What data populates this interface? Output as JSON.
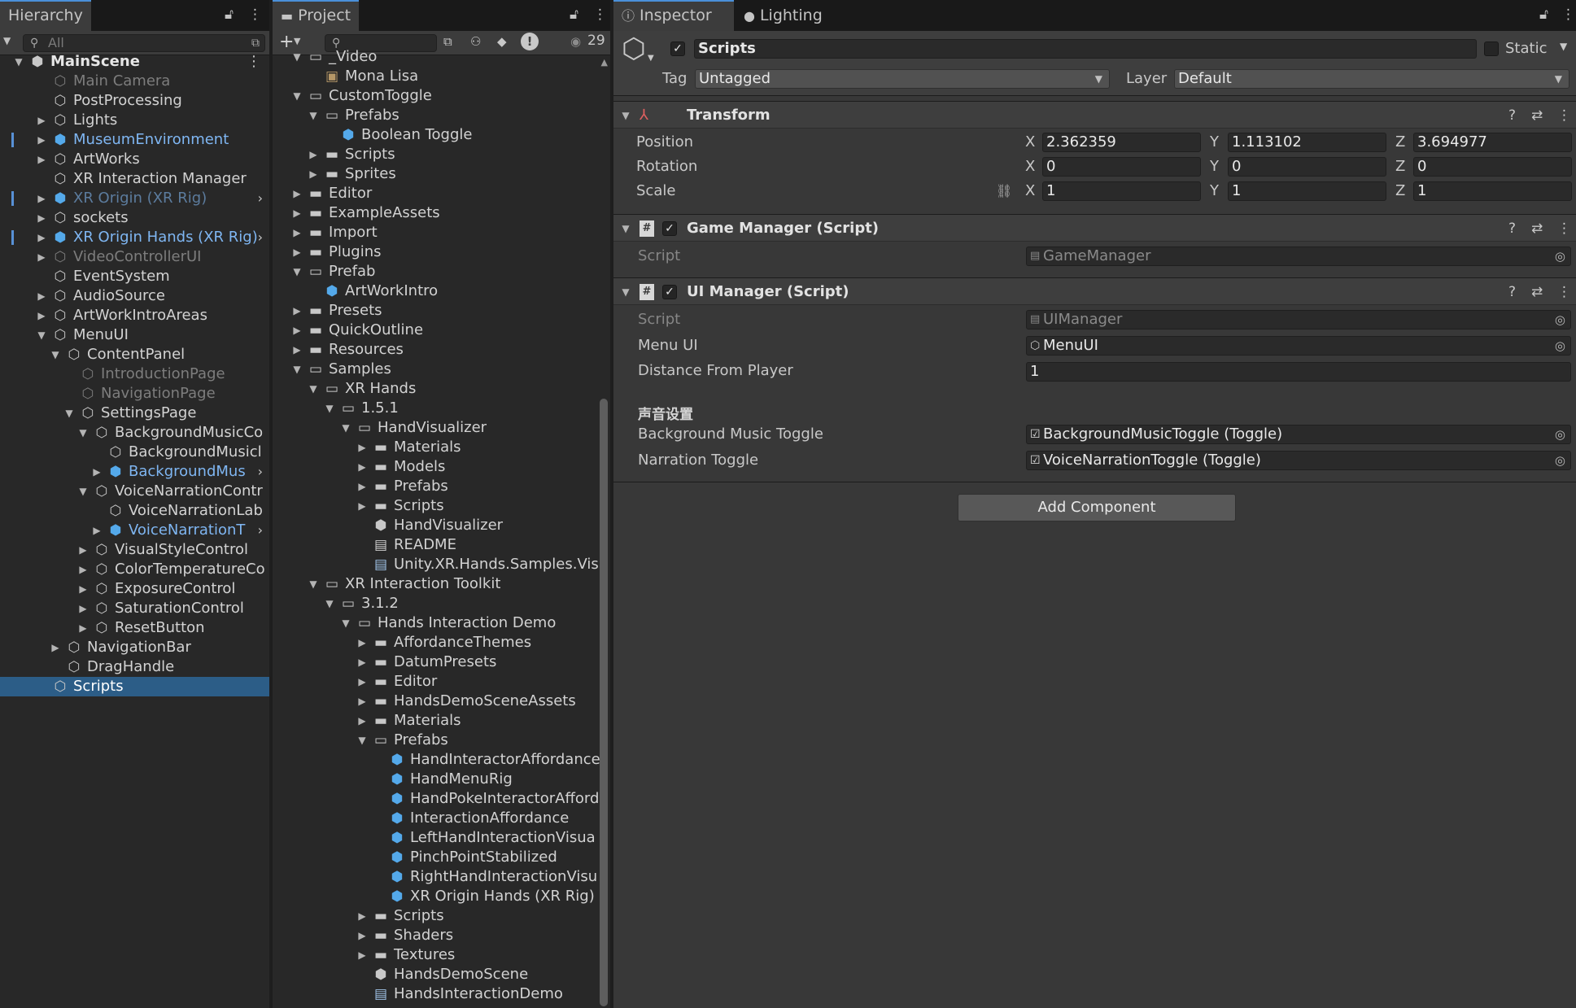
{
  "hierarchy": {
    "tab_label": "Hierarchy",
    "search_placeholder": "All",
    "scene_name": "MainScene",
    "items": [
      {
        "label": "Main Camera",
        "depth": 1,
        "arrow": "",
        "icon": "gameobject-icon",
        "style": "dim"
      },
      {
        "label": "PostProcessing",
        "depth": 1,
        "arrow": "",
        "icon": "gameobject-icon",
        "style": "normal"
      },
      {
        "label": "Lights",
        "depth": 1,
        "arrow": "right",
        "icon": "gameobject-icon",
        "style": "normal"
      },
      {
        "label": "MuseumEnvironment",
        "depth": 1,
        "arrow": "right",
        "icon": "prefab-icon",
        "style": "prefab",
        "stripe": true
      },
      {
        "label": "ArtWorks",
        "depth": 1,
        "arrow": "right",
        "icon": "gameobject-icon",
        "style": "normal"
      },
      {
        "label": "XR Interaction Manager",
        "depth": 1,
        "arrow": "",
        "icon": "gameobject-icon",
        "style": "normal"
      },
      {
        "label": "XR Origin (XR Rig)",
        "depth": 1,
        "arrow": "right",
        "icon": "prefab-icon",
        "style": "prefab-dim",
        "stripe": true,
        "chevron": true
      },
      {
        "label": "sockets",
        "depth": 1,
        "arrow": "right",
        "icon": "gameobject-icon",
        "style": "normal"
      },
      {
        "label": "XR Origin Hands (XR Rig)",
        "depth": 1,
        "arrow": "right",
        "icon": "prefab-icon",
        "style": "prefab",
        "stripe": true,
        "chevron": true
      },
      {
        "label": "VideoControllerUI",
        "depth": 1,
        "arrow": "right",
        "icon": "gameobject-icon",
        "style": "dim"
      },
      {
        "label": "EventSystem",
        "depth": 1,
        "arrow": "",
        "icon": "gameobject-icon",
        "style": "normal"
      },
      {
        "label": "AudioSource",
        "depth": 1,
        "arrow": "right",
        "icon": "gameobject-icon",
        "style": "normal"
      },
      {
        "label": "ArtWorkIntroAreas",
        "depth": 1,
        "arrow": "right",
        "icon": "gameobject-icon",
        "style": "normal"
      },
      {
        "label": "MenuUI",
        "depth": 1,
        "arrow": "down",
        "icon": "gameobject-icon",
        "style": "normal"
      },
      {
        "label": "ContentPanel",
        "depth": 2,
        "arrow": "down",
        "icon": "gameobject-icon",
        "style": "normal"
      },
      {
        "label": "IntroductionPage",
        "depth": 3,
        "arrow": "",
        "icon": "gameobject-icon",
        "style": "dim"
      },
      {
        "label": "NavigationPage",
        "depth": 3,
        "arrow": "",
        "icon": "gameobject-icon",
        "style": "dim"
      },
      {
        "label": "SettingsPage",
        "depth": 3,
        "arrow": "down",
        "icon": "gameobject-icon",
        "style": "normal"
      },
      {
        "label": "BackgroundMusicCo",
        "depth": 4,
        "arrow": "down",
        "icon": "gameobject-icon",
        "style": "normal"
      },
      {
        "label": "BackgroundMusicl",
        "depth": 5,
        "arrow": "",
        "icon": "gameobject-icon",
        "style": "normal"
      },
      {
        "label": "BackgroundMus",
        "depth": 5,
        "arrow": "right",
        "icon": "prefab-icon",
        "style": "prefab",
        "chevron": true
      },
      {
        "label": "VoiceNarrationContr",
        "depth": 4,
        "arrow": "down",
        "icon": "gameobject-icon",
        "style": "normal"
      },
      {
        "label": "VoiceNarrationLab",
        "depth": 5,
        "arrow": "",
        "icon": "gameobject-icon",
        "style": "normal"
      },
      {
        "label": "VoiceNarrationT",
        "depth": 5,
        "arrow": "right",
        "icon": "prefab-icon",
        "style": "prefab",
        "chevron": true
      },
      {
        "label": "VisualStyleControl",
        "depth": 4,
        "arrow": "right",
        "icon": "gameobject-icon",
        "style": "normal"
      },
      {
        "label": "ColorTemperatureCo",
        "depth": 4,
        "arrow": "right",
        "icon": "gameobject-icon",
        "style": "normal"
      },
      {
        "label": "ExposureControl",
        "depth": 4,
        "arrow": "right",
        "icon": "gameobject-icon",
        "style": "normal"
      },
      {
        "label": "SaturationControl",
        "depth": 4,
        "arrow": "right",
        "icon": "gameobject-icon",
        "style": "normal"
      },
      {
        "label": "ResetButton",
        "depth": 4,
        "arrow": "right",
        "icon": "gameobject-icon",
        "style": "normal"
      },
      {
        "label": "NavigationBar",
        "depth": 2,
        "arrow": "right",
        "icon": "gameobject-icon",
        "style": "normal"
      },
      {
        "label": "DragHandle",
        "depth": 2,
        "arrow": "",
        "icon": "gameobject-icon",
        "style": "normal"
      },
      {
        "label": "Scripts",
        "depth": 1,
        "arrow": "",
        "icon": "gameobject-icon",
        "style": "normal",
        "selected": true
      }
    ]
  },
  "project": {
    "tab_label": "Project",
    "hidden_count": "29",
    "items": [
      {
        "label": "_Video",
        "depth": 1,
        "arrow": "down",
        "icon": "folder-open-icon"
      },
      {
        "label": "Mona Lisa",
        "depth": 2,
        "arrow": "",
        "icon": "texture-icon"
      },
      {
        "label": "CustomToggle",
        "depth": 1,
        "arrow": "down",
        "icon": "folder-open-icon"
      },
      {
        "label": "Prefabs",
        "depth": 2,
        "arrow": "down",
        "icon": "folder-open-icon"
      },
      {
        "label": "Boolean Toggle",
        "depth": 3,
        "arrow": "",
        "icon": "prefab-icon"
      },
      {
        "label": "Scripts",
        "depth": 2,
        "arrow": "right",
        "icon": "folder-icon"
      },
      {
        "label": "Sprites",
        "depth": 2,
        "arrow": "right",
        "icon": "folder-icon"
      },
      {
        "label": "Editor",
        "depth": 1,
        "arrow": "right",
        "icon": "folder-icon"
      },
      {
        "label": "ExampleAssets",
        "depth": 1,
        "arrow": "right",
        "icon": "folder-icon"
      },
      {
        "label": "Import",
        "depth": 1,
        "arrow": "right",
        "icon": "folder-icon"
      },
      {
        "label": "Plugins",
        "depth": 1,
        "arrow": "right",
        "icon": "folder-icon"
      },
      {
        "label": "Prefab",
        "depth": 1,
        "arrow": "down",
        "icon": "folder-open-icon"
      },
      {
        "label": "ArtWorkIntro",
        "depth": 2,
        "arrow": "",
        "icon": "prefab-icon"
      },
      {
        "label": "Presets",
        "depth": 1,
        "arrow": "right",
        "icon": "folder-icon"
      },
      {
        "label": "QuickOutline",
        "depth": 1,
        "arrow": "right",
        "icon": "folder-icon"
      },
      {
        "label": "Resources",
        "depth": 1,
        "arrow": "right",
        "icon": "folder-icon"
      },
      {
        "label": "Samples",
        "depth": 1,
        "arrow": "down",
        "icon": "folder-open-icon"
      },
      {
        "label": "XR Hands",
        "depth": 2,
        "arrow": "down",
        "icon": "folder-open-icon"
      },
      {
        "label": "1.5.1",
        "depth": 3,
        "arrow": "down",
        "icon": "folder-open-icon"
      },
      {
        "label": "HandVisualizer",
        "depth": 4,
        "arrow": "down",
        "icon": "folder-open-icon"
      },
      {
        "label": "Materials",
        "depth": 5,
        "arrow": "right",
        "icon": "folder-icon"
      },
      {
        "label": "Models",
        "depth": 5,
        "arrow": "right",
        "icon": "folder-icon"
      },
      {
        "label": "Prefabs",
        "depth": 5,
        "arrow": "right",
        "icon": "folder-icon"
      },
      {
        "label": "Scripts",
        "depth": 5,
        "arrow": "right",
        "icon": "folder-icon"
      },
      {
        "label": "HandVisualizer",
        "depth": 5,
        "arrow": "",
        "icon": "scene-icon"
      },
      {
        "label": "README",
        "depth": 5,
        "arrow": "",
        "icon": "document-icon"
      },
      {
        "label": "Unity.XR.Hands.Samples.Vis",
        "depth": 5,
        "arrow": "",
        "icon": "asmdef-icon"
      },
      {
        "label": "XR Interaction Toolkit",
        "depth": 2,
        "arrow": "down",
        "icon": "folder-open-icon"
      },
      {
        "label": "3.1.2",
        "depth": 3,
        "arrow": "down",
        "icon": "folder-open-icon"
      },
      {
        "label": "Hands Interaction Demo",
        "depth": 4,
        "arrow": "down",
        "icon": "folder-open-icon"
      },
      {
        "label": "AffordanceThemes",
        "depth": 5,
        "arrow": "right",
        "icon": "folder-icon"
      },
      {
        "label": "DatumPresets",
        "depth": 5,
        "arrow": "right",
        "icon": "folder-icon"
      },
      {
        "label": "Editor",
        "depth": 5,
        "arrow": "right",
        "icon": "folder-icon"
      },
      {
        "label": "HandsDemoSceneAssets",
        "depth": 5,
        "arrow": "right",
        "icon": "folder-icon"
      },
      {
        "label": "Materials",
        "depth": 5,
        "arrow": "right",
        "icon": "folder-icon"
      },
      {
        "label": "Prefabs",
        "depth": 5,
        "arrow": "down",
        "icon": "folder-open-icon"
      },
      {
        "label": "HandInteractorAffordance",
        "depth": 6,
        "arrow": "",
        "icon": "prefab-icon"
      },
      {
        "label": "HandMenuRig",
        "depth": 6,
        "arrow": "",
        "icon": "prefab-icon"
      },
      {
        "label": "HandPokeInteractorAfford",
        "depth": 6,
        "arrow": "",
        "icon": "prefab-icon"
      },
      {
        "label": "InteractionAffordance",
        "depth": 6,
        "arrow": "",
        "icon": "prefab-icon"
      },
      {
        "label": "LeftHandInteractionVisua",
        "depth": 6,
        "arrow": "",
        "icon": "prefab-icon"
      },
      {
        "label": "PinchPointStabilized",
        "depth": 6,
        "arrow": "",
        "icon": "prefab-icon"
      },
      {
        "label": "RightHandInteractionVisu",
        "depth": 6,
        "arrow": "",
        "icon": "prefab-icon"
      },
      {
        "label": "XR Origin Hands (XR Rig)",
        "depth": 6,
        "arrow": "",
        "icon": "prefab-variant-icon"
      },
      {
        "label": "Scripts",
        "depth": 5,
        "arrow": "right",
        "icon": "folder-icon"
      },
      {
        "label": "Shaders",
        "depth": 5,
        "arrow": "right",
        "icon": "folder-icon"
      },
      {
        "label": "Textures",
        "depth": 5,
        "arrow": "right",
        "icon": "folder-icon"
      },
      {
        "label": "HandsDemoScene",
        "depth": 5,
        "arrow": "",
        "icon": "scene-icon"
      },
      {
        "label": "HandsInteractionDemo",
        "depth": 5,
        "arrow": "",
        "icon": "asmdef-icon"
      }
    ]
  },
  "inspector": {
    "tab_label": "Inspector",
    "lighting_tab_label": "Lighting",
    "object_name": "Scripts",
    "static_label": "Static",
    "tag_label": "Tag",
    "tag_value": "Untagged",
    "layer_label": "Layer",
    "layer_value": "Default",
    "transform": {
      "title": "Transform",
      "position_label": "Position",
      "rotation_label": "Rotation",
      "scale_label": "Scale",
      "position": {
        "x": "2.362359",
        "y": "1.113102",
        "z": "3.694977"
      },
      "rotation": {
        "x": "0",
        "y": "0",
        "z": "0"
      },
      "scale": {
        "x": "1",
        "y": "1",
        "z": "1"
      },
      "axis_x": "X",
      "axis_y": "Y",
      "axis_z": "Z"
    },
    "game_manager": {
      "title": "Game Manager (Script)",
      "script_label": "Script",
      "script_value": "GameManager"
    },
    "ui_manager": {
      "title": "UI Manager (Script)",
      "script_label": "Script",
      "script_value": "UIManager",
      "menu_ui_label": "Menu UI",
      "menu_ui_value": "MenuUI",
      "distance_label": "Distance From Player",
      "distance_value": "1",
      "section_header": "声音设置",
      "bg_music_label": "Background Music Toggle",
      "bg_music_value": "BackgroundMusicToggle (Toggle)",
      "narration_label": "Narration Toggle",
      "narration_value": "VoiceNarrationToggle (Toggle)"
    },
    "add_component_label": "Add Component"
  }
}
